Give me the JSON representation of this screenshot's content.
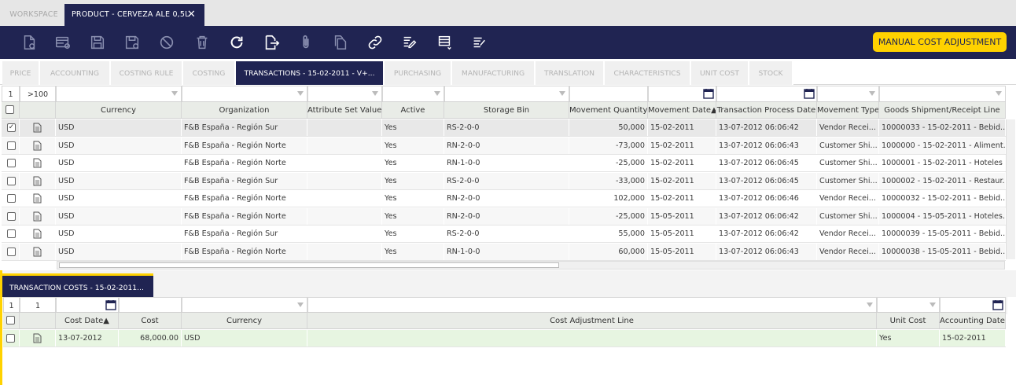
{
  "workspace_tabs": {
    "inactive_label": "WORKSPACE",
    "active_label": "PRODUCT - CERVEZA ALE 0,5L",
    "close_glyph": "✕"
  },
  "toolbar": {
    "icons": [
      "new-document-icon",
      "new-record-icon",
      "save-icon",
      "save-new-icon",
      "cancel-icon",
      "delete-icon",
      "refresh-icon",
      "export-icon",
      "attachment-icon",
      "copy-icon",
      "link-icon",
      "report-icon",
      "print-icon",
      "notes-icon"
    ],
    "manual_cost_adjustment_label": "MANUAL COST ADJUSTMENT",
    "accent_color": "#ffd200",
    "bar_color": "#202452"
  },
  "subtabs": [
    "PRICE",
    "ACCOUNTING",
    "COSTING RULE",
    "COSTING",
    "TRANSACTIONS - 15-02-2011 - V+...",
    "PURCHASING",
    "MANUFACTURING",
    "TRANSLATION",
    "CHARACTERISTICS",
    "UNIT COST",
    "STOCK"
  ],
  "transactions": {
    "filter_counter": "1",
    "filter_total": ">100",
    "columns": [
      "Currency",
      "Organization",
      "Attribute Set Value",
      "Active",
      "Storage Bin",
      "Movement Quantity",
      "Movement Date",
      "Transaction Process Date",
      "Movement Type",
      "Goods Shipment/Receipt Line"
    ],
    "sort_marker": "▲",
    "rows": [
      {
        "currency": "USD",
        "org": "F&B España - Región Sur",
        "attr": "",
        "active": "Yes",
        "bin": "RS-2-0-0",
        "qty": "50,000",
        "date": "15-02-2011",
        "proc": "13-07-2012 06:06:42",
        "type": "Vendor Recei...",
        "line": "10000033 - 15-02-2011 - Bebid...",
        "checked": "✓"
      },
      {
        "currency": "USD",
        "org": "F&B España - Región Norte",
        "attr": "",
        "active": "Yes",
        "bin": "RN-2-0-0",
        "qty": "-73,000",
        "date": "15-02-2011",
        "proc": "13-07-2012 06:06:43",
        "type": "Customer Shi...",
        "line": "1000000 - 15-02-2011 - Aliment...",
        "checked": ""
      },
      {
        "currency": "USD",
        "org": "F&B España - Región Norte",
        "attr": "",
        "active": "Yes",
        "bin": "RN-1-0-0",
        "qty": "-25,000",
        "date": "15-02-2011",
        "proc": "13-07-2012 06:06:45",
        "type": "Customer Shi...",
        "line": "1000001 - 15-02-2011 - Hoteles ...",
        "checked": ""
      },
      {
        "currency": "USD",
        "org": "F&B España - Región Sur",
        "attr": "",
        "active": "Yes",
        "bin": "RS-2-0-0",
        "qty": "-33,000",
        "date": "15-02-2011",
        "proc": "13-07-2012 06:06:45",
        "type": "Customer Shi...",
        "line": "1000002 - 15-02-2011 - Restaur...",
        "checked": ""
      },
      {
        "currency": "USD",
        "org": "F&B España - Región Norte",
        "attr": "",
        "active": "Yes",
        "bin": "RN-2-0-0",
        "qty": "102,000",
        "date": "15-02-2011",
        "proc": "13-07-2012 06:06:46",
        "type": "Vendor Recei...",
        "line": "10000032 - 15-02-2011 - Bebid...",
        "checked": ""
      },
      {
        "currency": "USD",
        "org": "F&B España - Región Norte",
        "attr": "",
        "active": "Yes",
        "bin": "RN-2-0-0",
        "qty": "-25,000",
        "date": "15-05-2011",
        "proc": "13-07-2012 06:06:42",
        "type": "Customer Shi...",
        "line": "1000004 - 15-05-2011 - Hoteles...",
        "checked": ""
      },
      {
        "currency": "USD",
        "org": "F&B España - Región Sur",
        "attr": "",
        "active": "Yes",
        "bin": "RS-2-0-0",
        "qty": "55,000",
        "date": "15-05-2011",
        "proc": "13-07-2012 06:06:42",
        "type": "Vendor Recei...",
        "line": "10000039 - 15-05-2011 - Bebid...",
        "checked": ""
      },
      {
        "currency": "USD",
        "org": "F&B España - Región Norte",
        "attr": "",
        "active": "Yes",
        "bin": "RN-1-0-0",
        "qty": "60,000",
        "date": "15-05-2011",
        "proc": "13-07-2012 06:06:43",
        "type": "Vendor Recei...",
        "line": "10000038 - 15-05-2011 - Bebid...",
        "checked": ""
      }
    ]
  },
  "transaction_costs": {
    "tab_label": "TRANSACTION COSTS - 15-02-2011...",
    "filter_counter": "1",
    "filter_total": "1",
    "columns": [
      "Cost Date",
      "Cost",
      "Currency",
      "Cost Adjustment Line",
      "Unit Cost",
      "Accounting Date"
    ],
    "sort_marker": "▲",
    "rows": [
      {
        "cost_date": "13-07-2012",
        "cost": "68,000.00",
        "currency": "USD",
        "adj_line": "",
        "unit_cost": "Yes",
        "acct_date": "15-02-2011"
      }
    ]
  }
}
